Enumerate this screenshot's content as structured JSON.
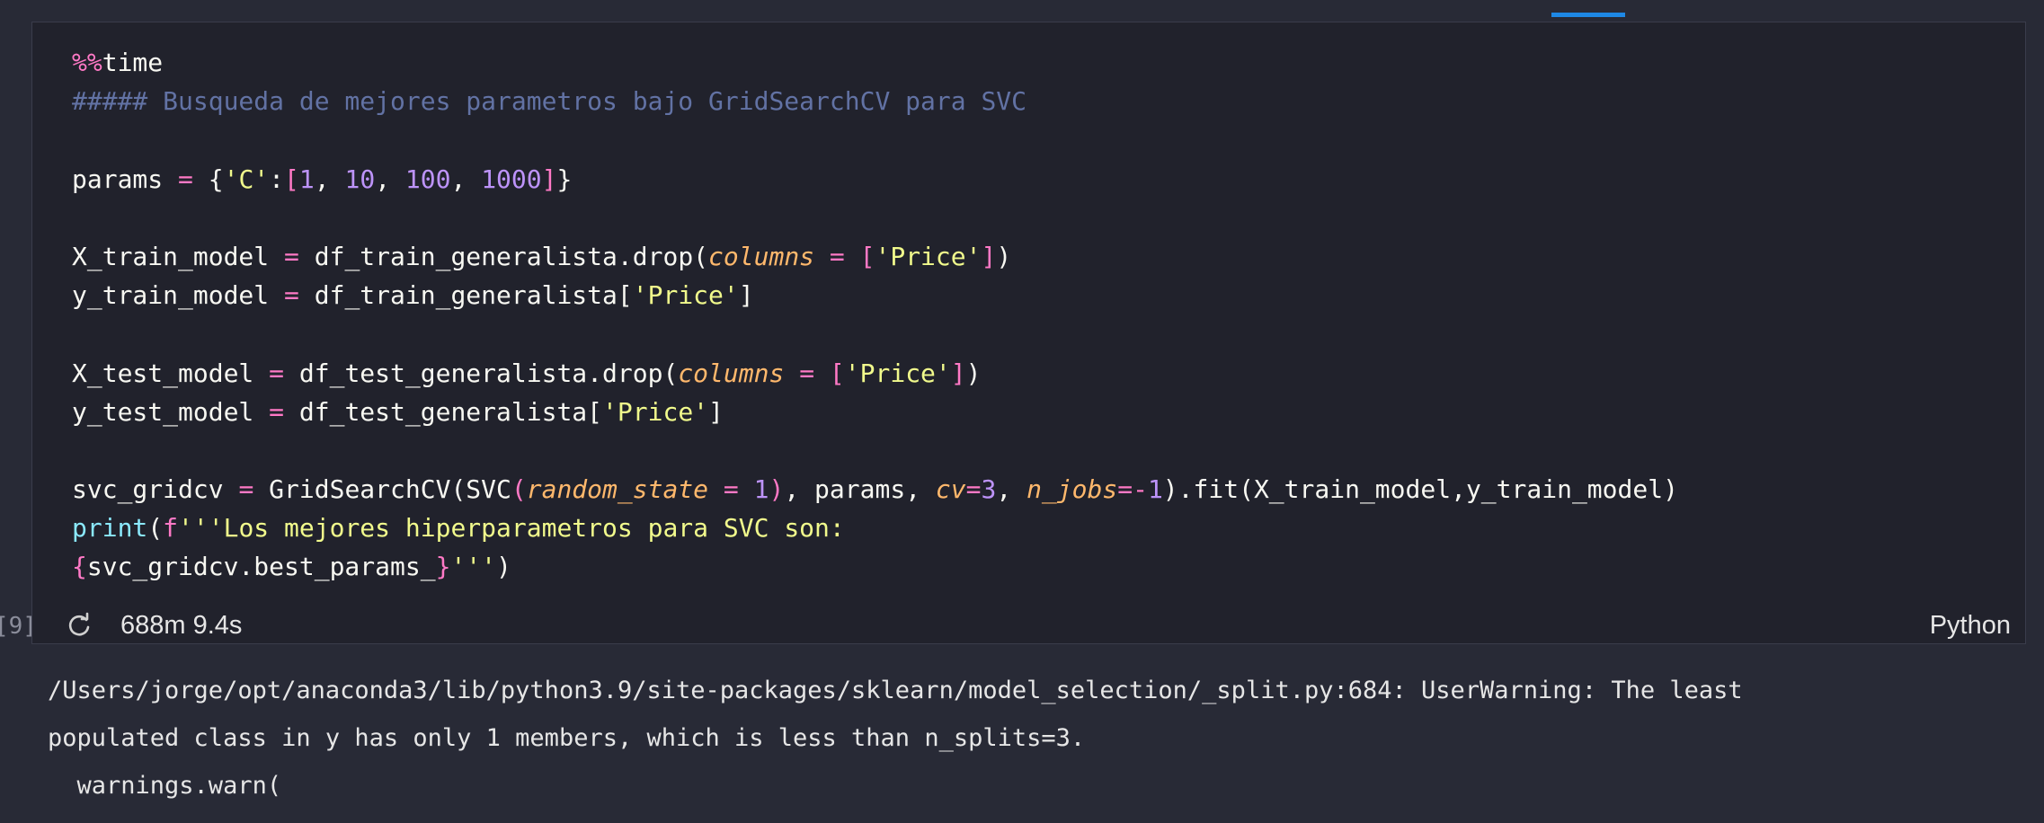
{
  "cell": {
    "code_lines": {
      "l1": {
        "magic": "%%",
        "text": "time"
      },
      "l2": "##### Busqueda de mejores parametros bajo GridSearchCV para SVC",
      "l4": {
        "name": "params",
        "eq": "=",
        "open": "{",
        "key": "'C'",
        "colon": ":",
        "lb": "[",
        "n1": "1",
        "c1": ", ",
        "n2": "10",
        "c2": ", ",
        "n3": "100",
        "c3": ", ",
        "n4": "1000",
        "rb": "]",
        "close": "}"
      },
      "l6": {
        "lhs": "X_train_model",
        "eq": "=",
        "call": "df_train_generalista.drop(",
        "kwarg": "columns",
        "kweq": "=",
        "lb": "[",
        "str": "'Price'",
        "rb": "]",
        "close": ")"
      },
      "l7": {
        "lhs": "y_train_model",
        "eq": "=",
        "rhs": "df_train_generalista[",
        "str": "'Price'",
        "close": "]"
      },
      "l9": {
        "lhs": "X_test_model",
        "eq": "=",
        "call": "df_test_generalista.drop(",
        "kwarg": "columns",
        "kweq": "=",
        "lb": "[",
        "str": "'Price'",
        "rb": "]",
        "close": ")"
      },
      "l10": {
        "lhs": "y_test_model",
        "eq": "=",
        "rhs": "df_test_generalista[",
        "str": "'Price'",
        "close": "]"
      },
      "l12": {
        "lhs": "svc_gridcv",
        "eq": "=",
        "call1": "GridSearchCV(SVC",
        "p1": "(",
        "kw1": "random_state",
        "eq1": "=",
        "n1": "1",
        "p2": ")",
        "mid": ", params, ",
        "kw2": "cv",
        "eq2": "=",
        "n2": "3",
        "sep": ", ",
        "kw3": "n_jobs",
        "eq3": "=",
        "neg": "-",
        "n3": "1",
        "tail": ").fit(X_train_model,y_train_model)"
      },
      "l13": {
        "fn": "print",
        "open": "(",
        "prefix": "f",
        "str": "'''Los mejores hiperparametros para SVC son:"
      },
      "l14": {
        "lb": "{",
        "expr": "svc_gridcv.best_params_",
        "rb": "}",
        "str": "'''",
        "close": ")"
      }
    },
    "footer": {
      "bracket": "[9]",
      "icon": "refresh-icon",
      "exec_time": "688m 9.4s",
      "language": "Python"
    }
  },
  "output": {
    "lines": [
      "/Users/jorge/opt/anaconda3/lib/python3.9/site-packages/sklearn/model_selection/_split.py:684: UserWarning: The least",
      "populated class in y has only 1 members, which is less than n_splits=3.",
      "  warnings.warn("
    ]
  },
  "colors": {
    "background": "#282a36",
    "cell_background": "#21222c",
    "comment": "#6272a4",
    "string": "#f1fa8c",
    "number": "#bd93f9",
    "operator": "#ff79c6",
    "param": "#ffb86c",
    "builtin": "#8be9fd",
    "tab_indicator": "#1e88e5"
  }
}
